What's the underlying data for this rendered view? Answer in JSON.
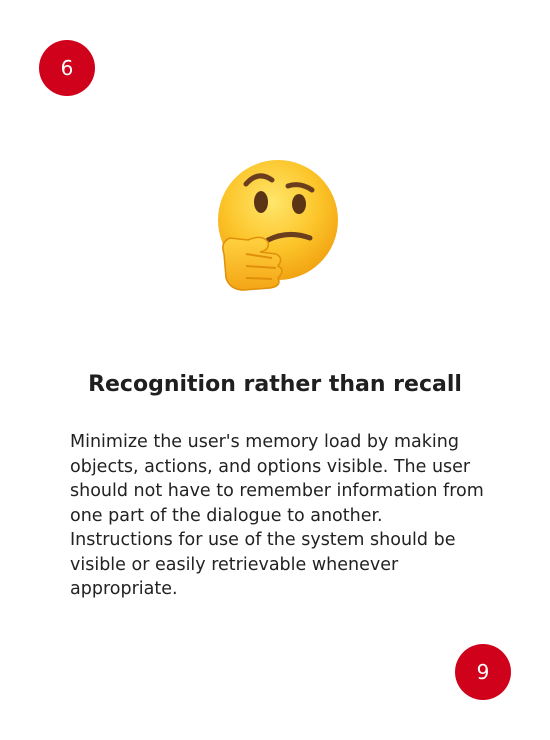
{
  "card": {
    "number_top": "6",
    "number_bottom": "9",
    "icon": "thinking-face-emoji",
    "title": "Recognition rather than recall",
    "description": "Minimize the user's memory load by making objects, actions, and options visible. The user should not have to remember information from one part of the dialogue to another. Instructions for use of the system should be visible or easily retrievable whenever appropriate."
  },
  "colors": {
    "badge": "#d0021b",
    "text": "#1f1f1f",
    "background": "#ffffff"
  }
}
